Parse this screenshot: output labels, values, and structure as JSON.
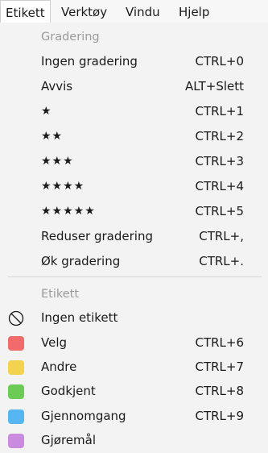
{
  "menubar": {
    "items": [
      {
        "label": "Etikett"
      },
      {
        "label": "Verktøy"
      },
      {
        "label": "Vindu"
      },
      {
        "label": "Hjelp"
      }
    ]
  },
  "rating_section": {
    "header": "Gradering",
    "items": [
      {
        "label": "Ingen gradering",
        "shortcut": "CTRL+0"
      },
      {
        "label": "Avvis",
        "shortcut": "ALT+Slett"
      },
      {
        "label": "★",
        "shortcut": "CTRL+1"
      },
      {
        "label": "★★",
        "shortcut": "CTRL+2"
      },
      {
        "label": "★★★",
        "shortcut": "CTRL+3"
      },
      {
        "label": "★★★★",
        "shortcut": "CTRL+4"
      },
      {
        "label": "★★★★★",
        "shortcut": "CTRL+5"
      },
      {
        "label": "Reduser gradering",
        "shortcut": "CTRL+,"
      },
      {
        "label": "Øk gradering",
        "shortcut": "CTRL+."
      }
    ]
  },
  "label_section": {
    "header": "Etikett",
    "items": [
      {
        "label": "Ingen etikett",
        "shortcut": "",
        "icon": "no-label-icon"
      },
      {
        "label": "Velg",
        "shortcut": "CTRL+6",
        "color": "#f26b6b"
      },
      {
        "label": "Andre",
        "shortcut": "CTRL+7",
        "color": "#f2d24f"
      },
      {
        "label": "Godkjent",
        "shortcut": "CTRL+8",
        "color": "#6ccb55"
      },
      {
        "label": "Gjennomgang",
        "shortcut": "CTRL+9",
        "color": "#55b6f2"
      },
      {
        "label": "Gjøremål",
        "shortcut": "",
        "color": "#c98ae0"
      }
    ]
  }
}
